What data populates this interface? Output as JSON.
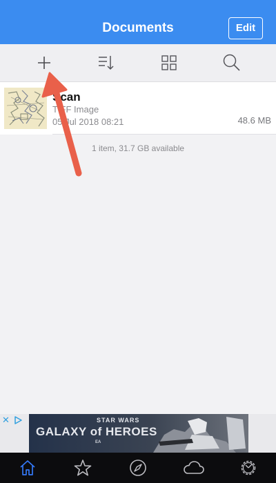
{
  "header": {
    "title": "Documents",
    "edit_label": "Edit"
  },
  "toolbar": {
    "items": [
      {
        "name": "add",
        "icon": "plus-icon"
      },
      {
        "name": "sort",
        "icon": "sort-icon"
      },
      {
        "name": "view",
        "icon": "grid-icon"
      },
      {
        "name": "search",
        "icon": "search-icon"
      }
    ]
  },
  "files": [
    {
      "name": "Scan",
      "type": "TIFF Image",
      "date": "05 Jul 2018 08:21",
      "size": "48.6 MB"
    }
  ],
  "storage_summary": "1 item, 31.7 GB available",
  "ad": {
    "close_icon": "close-icon",
    "choices_icon": "ad-choices-icon",
    "line1": "STAR WARS",
    "line2": "GALAXY of HEROES",
    "line3": "EA"
  },
  "tab_bar": {
    "items": [
      {
        "name": "home",
        "icon": "house-icon",
        "active": true
      },
      {
        "name": "favorites",
        "icon": "star-icon",
        "active": false
      },
      {
        "name": "browser",
        "icon": "compass-icon",
        "active": false
      },
      {
        "name": "cloud",
        "icon": "cloud-icon",
        "active": false
      },
      {
        "name": "settings",
        "icon": "gear-icon",
        "active": false
      }
    ]
  },
  "colors": {
    "header": "#3b8cf0",
    "toolbar": "#efeff2",
    "accent": "#3478f6",
    "arrow": "#e9604a",
    "tab_bar": "#0c0c0e"
  }
}
